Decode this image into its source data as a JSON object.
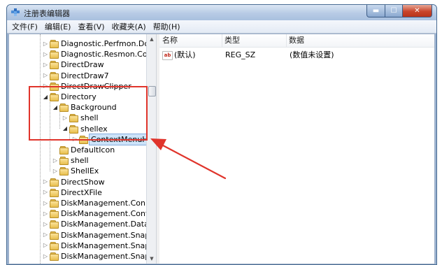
{
  "window": {
    "title": "注册表编辑器",
    "controls": {
      "minimize": "▬",
      "maximize": "☐",
      "close": "✕"
    }
  },
  "menu": [
    {
      "label": "文件(F)"
    },
    {
      "label": "编辑(E)"
    },
    {
      "label": "查看(V)"
    },
    {
      "label": "收藏夹(A)"
    },
    {
      "label": "帮助(H)"
    }
  ],
  "tree": [
    {
      "label": "Diagnostic.Perfmon.Documer",
      "depth": 0,
      "expander": "collapsed"
    },
    {
      "label": "Diagnostic.Resmon.Config",
      "depth": 0,
      "expander": "collapsed"
    },
    {
      "label": "DirectDraw",
      "depth": 0,
      "expander": "collapsed"
    },
    {
      "label": "DirectDraw7",
      "depth": 0,
      "expander": "collapsed"
    },
    {
      "label": "DirectDrawClipper",
      "depth": 0,
      "expander": "collapsed"
    },
    {
      "label": "Directory",
      "depth": 0,
      "expander": "expanded"
    },
    {
      "label": "Background",
      "depth": 1,
      "expander": "expanded"
    },
    {
      "label": "shell",
      "depth": 2,
      "expander": "collapsed"
    },
    {
      "label": "shellex",
      "depth": 2,
      "expander": "expanded"
    },
    {
      "label": "ContextMenuHand",
      "depth": 3,
      "expander": "collapsed",
      "selected": true
    },
    {
      "label": "DefaultIcon",
      "depth": 1,
      "expander": "none"
    },
    {
      "label": "shell",
      "depth": 1,
      "expander": "collapsed"
    },
    {
      "label": "ShellEx",
      "depth": 1,
      "expander": "collapsed"
    },
    {
      "label": "DirectShow",
      "depth": 0,
      "expander": "collapsed"
    },
    {
      "label": "DirectXFile",
      "depth": 0,
      "expander": "collapsed"
    },
    {
      "label": "DiskManagement.Connection",
      "depth": 0,
      "expander": "collapsed"
    },
    {
      "label": "DiskManagement.Control",
      "depth": 0,
      "expander": "collapsed"
    },
    {
      "label": "DiskManagement.DataObjec",
      "depth": 0,
      "expander": "collapsed"
    },
    {
      "label": "DiskManagement.SnapIn",
      "depth": 0,
      "expander": "collapsed"
    },
    {
      "label": "DiskManagement.SnapInAbc",
      "depth": 0,
      "expander": "collapsed"
    },
    {
      "label": "DiskManagement.SnapInCor",
      "depth": 0,
      "expander": "collapsed"
    }
  ],
  "list": {
    "columns": {
      "name": "名称",
      "type": "类型",
      "data": "数据"
    },
    "rows": [
      {
        "icon": "ab",
        "name": "(默认)",
        "type": "REG_SZ",
        "data": "(数值未设置)"
      }
    ]
  },
  "annotation": {
    "color": "#e0342b"
  },
  "colors": {
    "selection": "#cde3f9",
    "folder": "#f0c75e",
    "title_bar": "#b7cbe5"
  }
}
